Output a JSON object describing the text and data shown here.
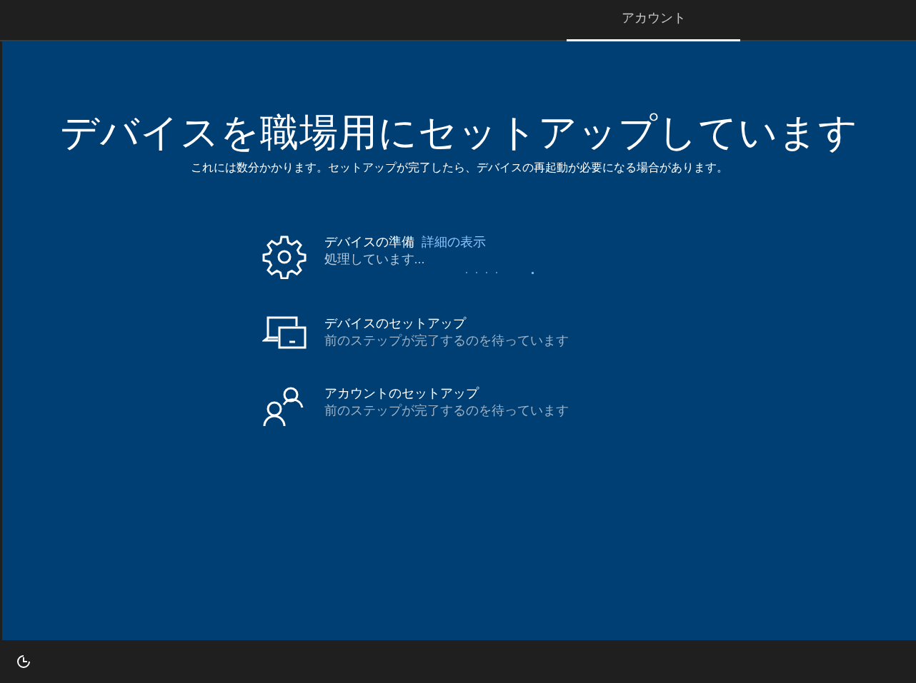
{
  "tabs": [
    {
      "label": "アカウント",
      "selected": true
    }
  ],
  "heading": "デバイスを職場用にセットアップしています",
  "subheading": "これには数分かかります。セットアップが完了したら、デバイスの再起動が必要になる場合があります。",
  "steps": [
    {
      "kind": "gear",
      "title": "デバイスの準備",
      "link": "詳細の表示",
      "status": "処理しています...",
      "active": true
    },
    {
      "kind": "devices",
      "title": "デバイスのセットアップ",
      "status": "前のステップが完了するのを待っています",
      "active": false
    },
    {
      "kind": "people",
      "title": "アカウントのセットアップ",
      "status": "前のステップが完了するのを待っています",
      "active": false
    }
  ]
}
